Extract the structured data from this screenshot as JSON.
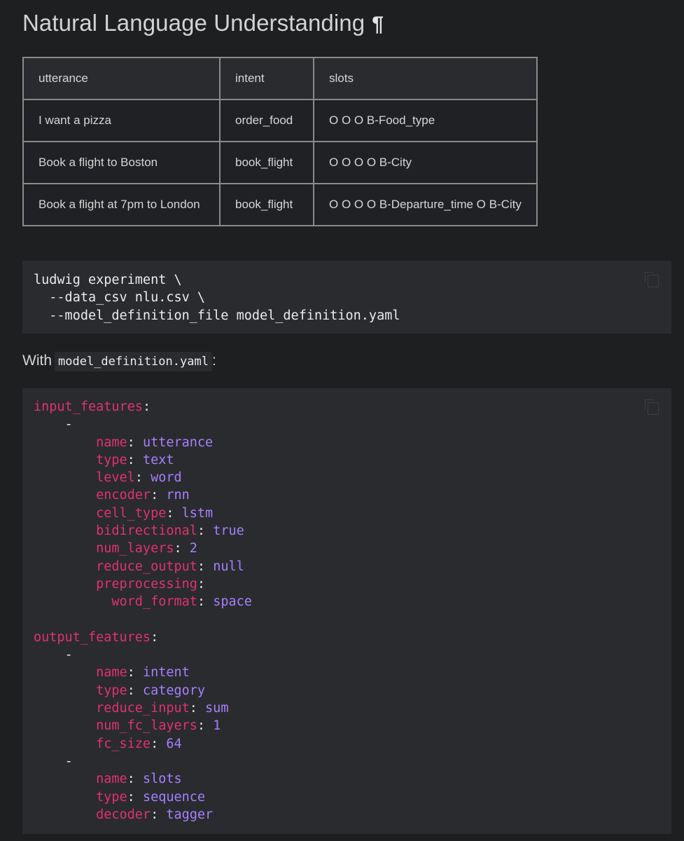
{
  "page": {
    "title": "Natural Language Understanding",
    "anchor_symbol": "¶"
  },
  "table": {
    "headers": [
      "utterance",
      "intent",
      "slots"
    ],
    "rows": [
      [
        "I want a pizza",
        "order_food",
        "O O O B-Food_type"
      ],
      [
        "Book a flight to Boston",
        "book_flight",
        "O O O O B-City"
      ],
      [
        "Book a flight at 7pm to London",
        "book_flight",
        "O O O O B-Departure_time O B-City"
      ]
    ]
  },
  "command_block": {
    "lines": [
      "ludwig experiment \\",
      "  --data_csv nlu.csv \\",
      "  --model_definition_file model_definition.yaml"
    ],
    "copy_icon": "copy-icon"
  },
  "with_text": {
    "prefix": "With",
    "code": "model_definition.yaml",
    "suffix": ":"
  },
  "yaml_block": {
    "copy_icon": "copy-icon",
    "lines": [
      {
        "indent": "",
        "key": "input_features",
        "value": ""
      },
      {
        "indent": "    ",
        "dash": "-"
      },
      {
        "indent": "        ",
        "key": "name",
        "value": "utterance"
      },
      {
        "indent": "        ",
        "key": "type",
        "value": "text"
      },
      {
        "indent": "        ",
        "key": "level",
        "value": "word"
      },
      {
        "indent": "        ",
        "key": "encoder",
        "value": "rnn"
      },
      {
        "indent": "        ",
        "key": "cell_type",
        "value": "lstm"
      },
      {
        "indent": "        ",
        "key": "bidirectional",
        "value": "true"
      },
      {
        "indent": "        ",
        "key": "num_layers",
        "value": "2"
      },
      {
        "indent": "        ",
        "key": "reduce_output",
        "value": "null"
      },
      {
        "indent": "        ",
        "key": "preprocessing",
        "value": ""
      },
      {
        "indent": "          ",
        "key": "word_format",
        "value": "space"
      },
      {
        "blank": true
      },
      {
        "indent": "",
        "key": "output_features",
        "value": ""
      },
      {
        "indent": "    ",
        "dash": "-"
      },
      {
        "indent": "        ",
        "key": "name",
        "value": "intent"
      },
      {
        "indent": "        ",
        "key": "type",
        "value": "category"
      },
      {
        "indent": "        ",
        "key": "reduce_input",
        "value": "sum"
      },
      {
        "indent": "        ",
        "key": "num_fc_layers",
        "value": "1"
      },
      {
        "indent": "        ",
        "key": "fc_size",
        "value": "64"
      },
      {
        "indent": "    ",
        "dash": "-"
      },
      {
        "indent": "        ",
        "key": "name",
        "value": "slots"
      },
      {
        "indent": "        ",
        "key": "type",
        "value": "sequence"
      },
      {
        "indent": "        ",
        "key": "decoder",
        "value": "tagger"
      }
    ]
  },
  "colors": {
    "background": "#1e1f21",
    "code_background": "#2a2b2e",
    "yaml_key": "#e0326f",
    "yaml_value": "#a580ff",
    "table_border": "#8a8a8a"
  }
}
